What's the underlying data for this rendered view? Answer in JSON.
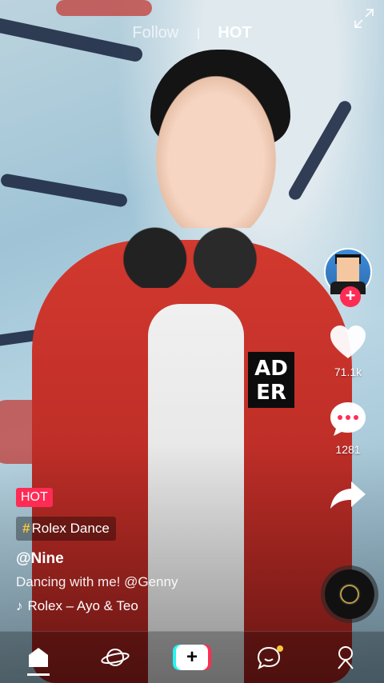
{
  "top_tabs": {
    "follow": "Follow",
    "hot": "HOT"
  },
  "rail": {
    "likes": "71.1k",
    "comments": "1281"
  },
  "caption": {
    "badge": "HOT",
    "tag": "Rolex Dance",
    "tag_prefix": "#",
    "username": "@Nine",
    "description": "Dancing with me! @Genny",
    "music": "Rolex – Ayo & Teo"
  },
  "patch_text": "AD\nER",
  "colors": {
    "accent": "#fe2c55",
    "tag_hash": "#f7c73b",
    "cyan": "#25f4ee"
  },
  "icons": [
    "expand-icon",
    "heart-icon",
    "comment-icon",
    "share-icon",
    "music-note-icon",
    "home-icon",
    "discover-icon",
    "create-icon",
    "messages-icon",
    "profile-icon"
  ]
}
